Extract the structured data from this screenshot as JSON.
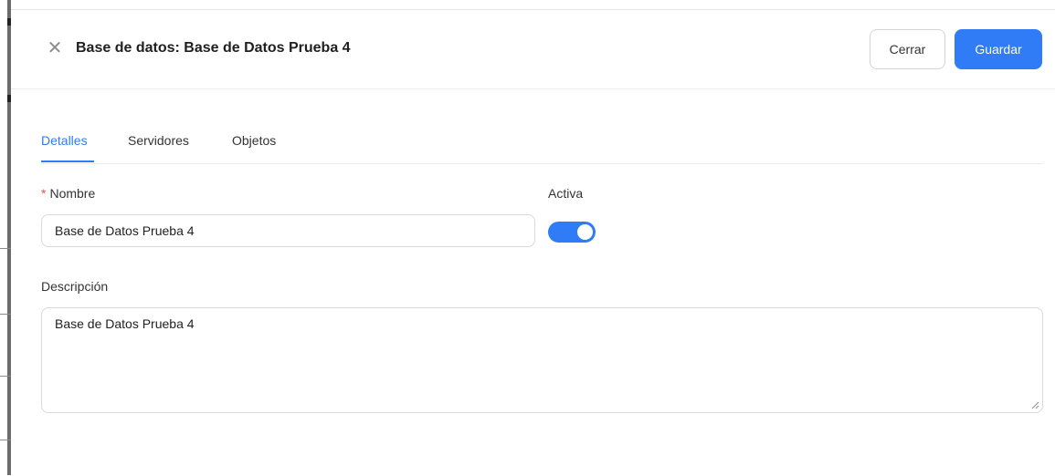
{
  "header": {
    "title": "Base de datos: Base de Datos Prueba 4",
    "close_icon": "close-icon",
    "cerrar_label": "Cerrar",
    "guardar_label": "Guardar"
  },
  "tabs": [
    {
      "label": "Detalles",
      "active": true
    },
    {
      "label": "Servidores",
      "active": false
    },
    {
      "label": "Objetos",
      "active": false
    }
  ],
  "form": {
    "nombre_label": "Nombre",
    "nombre_required_mark": "*",
    "nombre_value": "Base de Datos Prueba 4",
    "activa_label": "Activa",
    "activa_on": true,
    "descripcion_label": "Descripción",
    "descripcion_value": "Base de Datos Prueba 4"
  },
  "colors": {
    "accent": "#2f7cf6",
    "required": "#ff4d4f"
  }
}
